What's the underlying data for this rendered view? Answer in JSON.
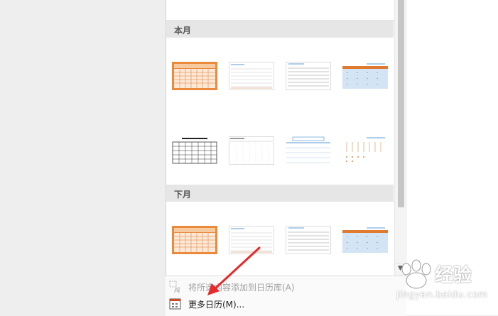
{
  "sections": [
    {
      "title": "本月"
    },
    {
      "title": "下月"
    }
  ],
  "menu": {
    "add_selection": {
      "label": "将所选内容添加到日历库(A)",
      "enabled": false
    },
    "more_calendars": {
      "label": "更多日历(M)...",
      "enabled": true
    }
  },
  "watermark": {
    "text": "经验",
    "url": "jingyan.baidu.com"
  },
  "colors": {
    "orange": "#e07a2e",
    "blue": "#5b9bd5",
    "header_bg": "#e6e6e6"
  }
}
